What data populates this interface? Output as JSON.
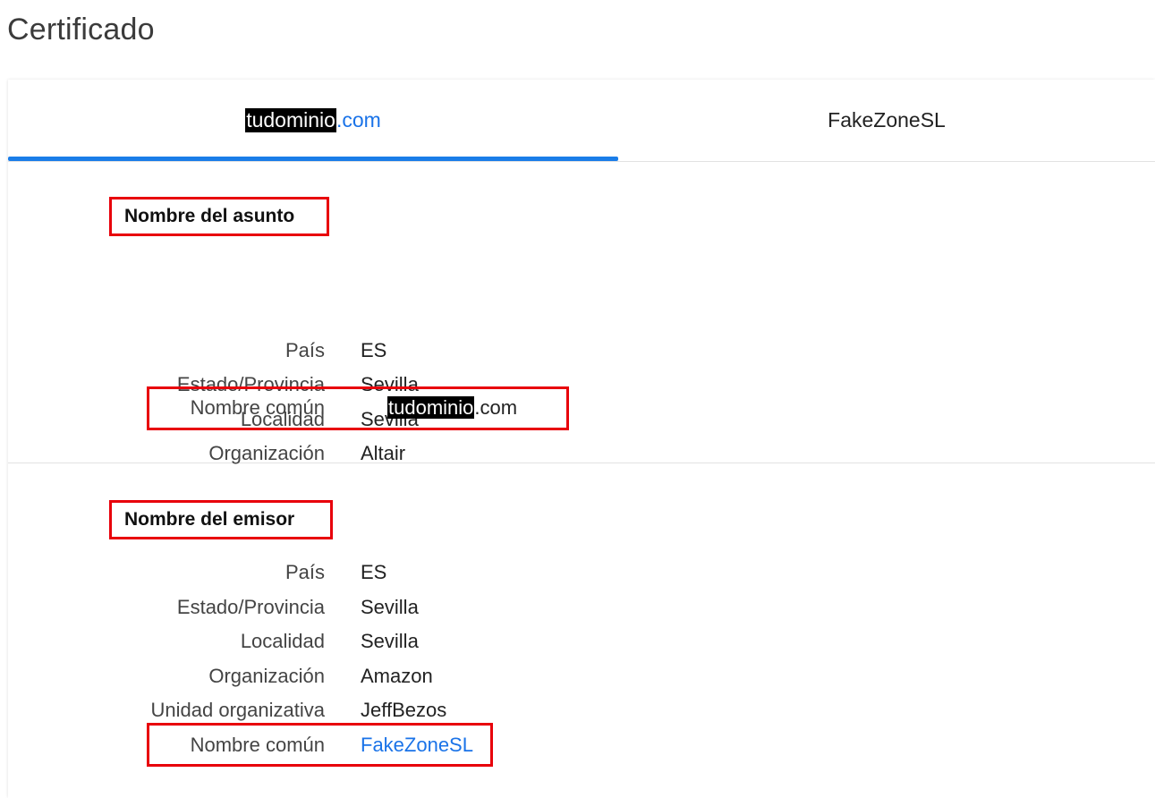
{
  "page": {
    "title": "Certificado"
  },
  "tabs": [
    {
      "label_highlight": "tudominio",
      "label_suffix": ".com",
      "active": true
    },
    {
      "label": "FakeZoneSL",
      "active": false
    }
  ],
  "subject": {
    "heading": "Nombre del asunto",
    "rows": [
      {
        "label": "País",
        "value": "ES"
      },
      {
        "label": "Estado/Provincia",
        "value": "Sevilla"
      },
      {
        "label": "Localidad",
        "value": "Sevilla"
      },
      {
        "label": "Organización",
        "value": "Altair"
      },
      {
        "label": "Nombre común",
        "value_highlight": "tudominio",
        "value_suffix": ".com"
      }
    ]
  },
  "issuer": {
    "heading": "Nombre del emisor",
    "rows": [
      {
        "label": "País",
        "value": "ES"
      },
      {
        "label": "Estado/Provincia",
        "value": "Sevilla"
      },
      {
        "label": "Localidad",
        "value": "Sevilla"
      },
      {
        "label": "Organización",
        "value": "Amazon"
      },
      {
        "label": "Unidad organizativa",
        "value": "JeffBezos"
      },
      {
        "label": "Nombre común",
        "value": "FakeZoneSL"
      }
    ]
  },
  "colors": {
    "accent": "#1a7de8",
    "link": "#1a73e8",
    "annotation_box": "#e8000b"
  }
}
